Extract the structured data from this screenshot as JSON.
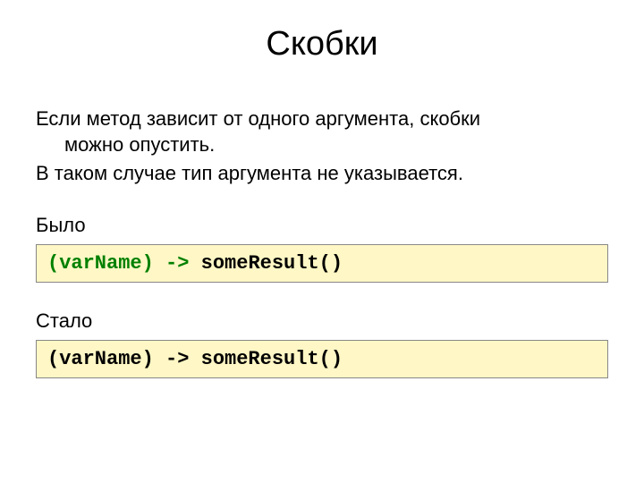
{
  "slide": {
    "title": "Скобки",
    "paragraph1_line1": "Если метод зависит от одного аргумента, скобки",
    "paragraph1_line2": "можно опустить.",
    "paragraph2": "В таком случае тип аргумента не указывается.",
    "label_before": "Было",
    "label_after": "Стало",
    "code_before": {
      "open_paren": "(",
      "var": "varName",
      "close_paren": ")",
      "space1": " ",
      "arrow": "->",
      "space2": " ",
      "call": "someResult()"
    },
    "code_after": {
      "full": "(varName) -> someResult()"
    }
  }
}
